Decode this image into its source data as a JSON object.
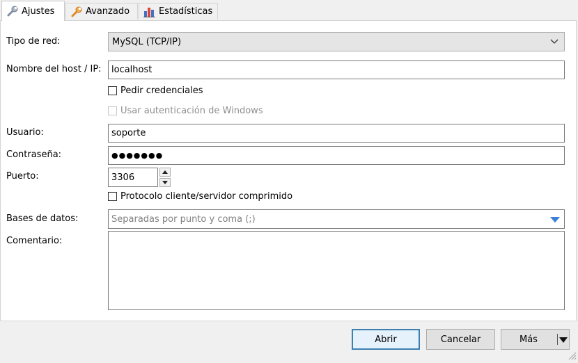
{
  "tabs": [
    {
      "label": "Ajustes",
      "icon": "wrench-icon",
      "active": true
    },
    {
      "label": "Avanzado",
      "icon": "wrench-orange-icon",
      "active": false
    },
    {
      "label": "Estadísticas",
      "icon": "bar-chart-icon",
      "active": false
    }
  ],
  "form": {
    "network_type": {
      "label": "Tipo de red:",
      "value": "MySQL (TCP/IP)"
    },
    "host": {
      "label": "Nombre del host / IP:",
      "value": "localhost"
    },
    "ask_credentials": {
      "label": "Pedir credenciales",
      "checked": false
    },
    "windows_auth": {
      "label": "Usar autenticación de Windows",
      "checked": false,
      "enabled": false
    },
    "user": {
      "label": "Usuario:",
      "value": "soporte"
    },
    "password": {
      "label": "Contraseña:",
      "value": "●●●●●●●"
    },
    "port": {
      "label": "Puerto:",
      "value": "3306"
    },
    "compressed": {
      "label": "Protocolo cliente/servidor comprimido",
      "checked": false
    },
    "databases": {
      "label": "Bases de datos:",
      "placeholder": "Separadas por punto y coma (;)"
    },
    "comment": {
      "label": "Comentario:",
      "value": ""
    }
  },
  "buttons": {
    "open": "Abrir",
    "cancel": "Cancelar",
    "more": "Más"
  },
  "colors": {
    "default_button_border": "#3c7fb1",
    "dropdown_arrow": "#3c7fd8"
  }
}
